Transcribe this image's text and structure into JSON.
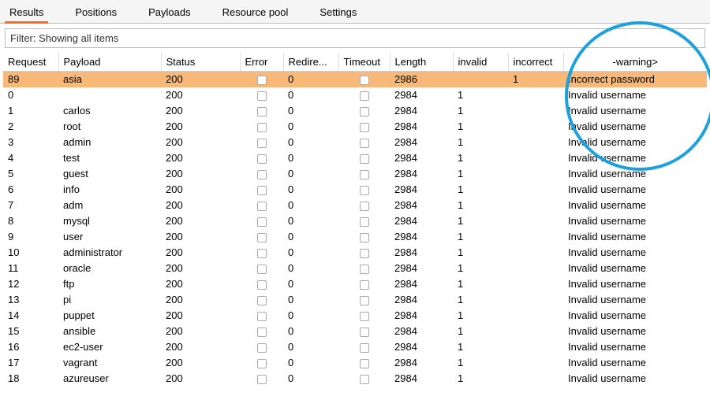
{
  "tabs": {
    "results": "Results",
    "positions": "Positions",
    "payloads": "Payloads",
    "resource_pool": "Resource pool",
    "settings": "Settings"
  },
  "filter_text": "Filter: Showing all items",
  "columns": {
    "request": "Request",
    "payload": "Payload",
    "status": "Status",
    "error": "Error",
    "redire": "Redire...",
    "timeout": "Timeout",
    "length": "Length",
    "invalid": "invalid",
    "incorrect": "incorrect",
    "warning": "-warning>"
  },
  "rows": [
    {
      "request": "89",
      "payload": "asia",
      "status": "200",
      "error": false,
      "redire": "0",
      "timeout": false,
      "length": "2986",
      "invalid": "",
      "incorrect": "1",
      "warning": "Incorrect password",
      "selected": true
    },
    {
      "request": "0",
      "payload": "",
      "status": "200",
      "error": false,
      "redire": "0",
      "timeout": false,
      "length": "2984",
      "invalid": "1",
      "incorrect": "",
      "warning": "Invalid username"
    },
    {
      "request": "1",
      "payload": "carlos",
      "status": "200",
      "error": false,
      "redire": "0",
      "timeout": false,
      "length": "2984",
      "invalid": "1",
      "incorrect": "",
      "warning": "Invalid username"
    },
    {
      "request": "2",
      "payload": "root",
      "status": "200",
      "error": false,
      "redire": "0",
      "timeout": false,
      "length": "2984",
      "invalid": "1",
      "incorrect": "",
      "warning": "Invalid username"
    },
    {
      "request": "3",
      "payload": "admin",
      "status": "200",
      "error": false,
      "redire": "0",
      "timeout": false,
      "length": "2984",
      "invalid": "1",
      "incorrect": "",
      "warning": "Invalid username"
    },
    {
      "request": "4",
      "payload": "test",
      "status": "200",
      "error": false,
      "redire": "0",
      "timeout": false,
      "length": "2984",
      "invalid": "1",
      "incorrect": "",
      "warning": "Invalid username"
    },
    {
      "request": "5",
      "payload": "guest",
      "status": "200",
      "error": false,
      "redire": "0",
      "timeout": false,
      "length": "2984",
      "invalid": "1",
      "incorrect": "",
      "warning": "Invalid username"
    },
    {
      "request": "6",
      "payload": "info",
      "status": "200",
      "error": false,
      "redire": "0",
      "timeout": false,
      "length": "2984",
      "invalid": "1",
      "incorrect": "",
      "warning": "Invalid username"
    },
    {
      "request": "7",
      "payload": "adm",
      "status": "200",
      "error": false,
      "redire": "0",
      "timeout": false,
      "length": "2984",
      "invalid": "1",
      "incorrect": "",
      "warning": "Invalid username"
    },
    {
      "request": "8",
      "payload": "mysql",
      "status": "200",
      "error": false,
      "redire": "0",
      "timeout": false,
      "length": "2984",
      "invalid": "1",
      "incorrect": "",
      "warning": "Invalid username"
    },
    {
      "request": "9",
      "payload": "user",
      "status": "200",
      "error": false,
      "redire": "0",
      "timeout": false,
      "length": "2984",
      "invalid": "1",
      "incorrect": "",
      "warning": "Invalid username"
    },
    {
      "request": "10",
      "payload": "administrator",
      "status": "200",
      "error": false,
      "redire": "0",
      "timeout": false,
      "length": "2984",
      "invalid": "1",
      "incorrect": "",
      "warning": "Invalid username"
    },
    {
      "request": "11",
      "payload": "oracle",
      "status": "200",
      "error": false,
      "redire": "0",
      "timeout": false,
      "length": "2984",
      "invalid": "1",
      "incorrect": "",
      "warning": "Invalid username"
    },
    {
      "request": "12",
      "payload": "ftp",
      "status": "200",
      "error": false,
      "redire": "0",
      "timeout": false,
      "length": "2984",
      "invalid": "1",
      "incorrect": "",
      "warning": "Invalid username"
    },
    {
      "request": "13",
      "payload": "pi",
      "status": "200",
      "error": false,
      "redire": "0",
      "timeout": false,
      "length": "2984",
      "invalid": "1",
      "incorrect": "",
      "warning": "Invalid username"
    },
    {
      "request": "14",
      "payload": "puppet",
      "status": "200",
      "error": false,
      "redire": "0",
      "timeout": false,
      "length": "2984",
      "invalid": "1",
      "incorrect": "",
      "warning": "Invalid username"
    },
    {
      "request": "15",
      "payload": "ansible",
      "status": "200",
      "error": false,
      "redire": "0",
      "timeout": false,
      "length": "2984",
      "invalid": "1",
      "incorrect": "",
      "warning": "Invalid username"
    },
    {
      "request": "16",
      "payload": "ec2-user",
      "status": "200",
      "error": false,
      "redire": "0",
      "timeout": false,
      "length": "2984",
      "invalid": "1",
      "incorrect": "",
      "warning": "Invalid username"
    },
    {
      "request": "17",
      "payload": "vagrant",
      "status": "200",
      "error": false,
      "redire": "0",
      "timeout": false,
      "length": "2984",
      "invalid": "1",
      "incorrect": "",
      "warning": "Invalid username"
    },
    {
      "request": "18",
      "payload": "azureuser",
      "status": "200",
      "error": false,
      "redire": "0",
      "timeout": false,
      "length": "2984",
      "invalid": "1",
      "incorrect": "",
      "warning": "Invalid username"
    }
  ]
}
